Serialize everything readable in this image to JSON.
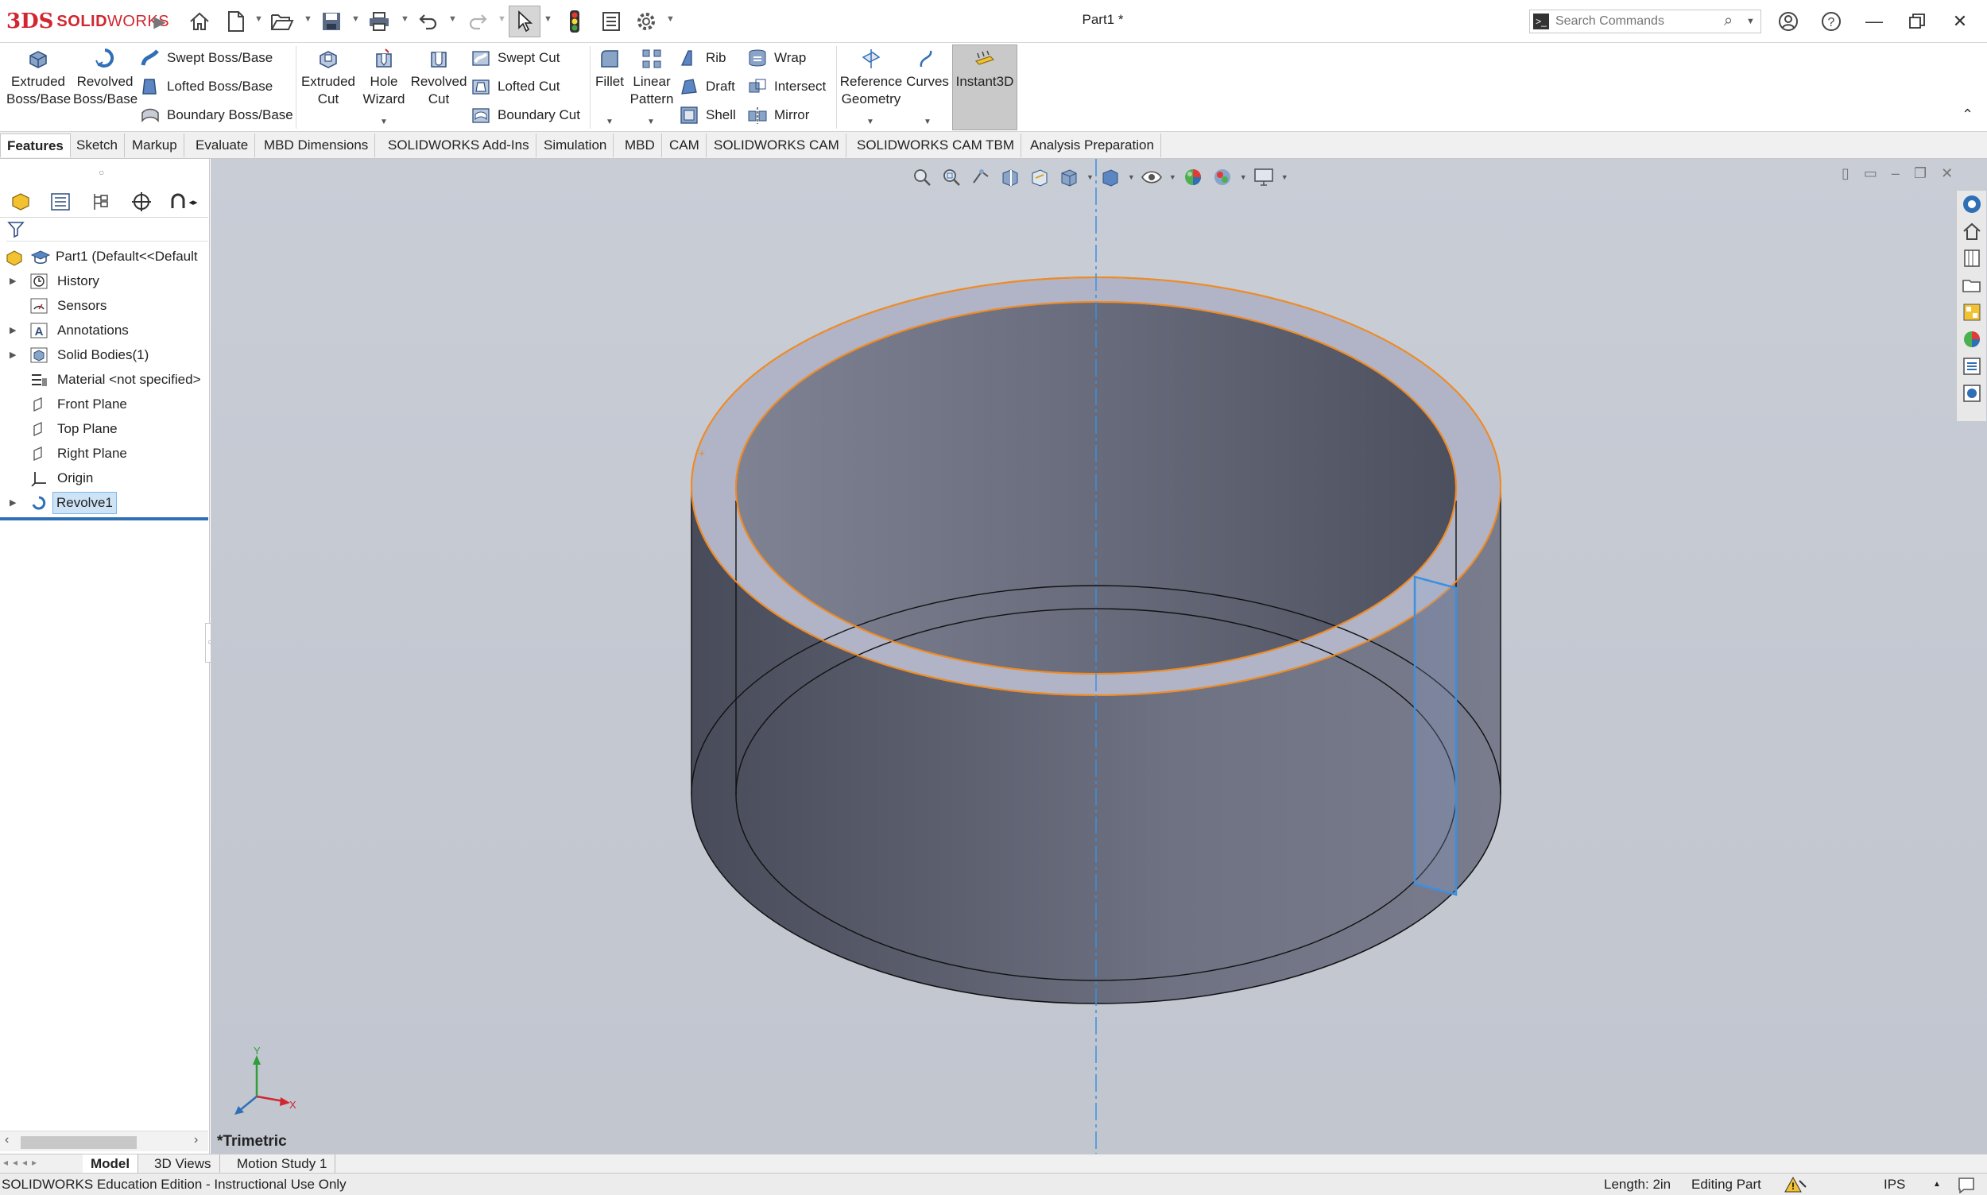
{
  "app": {
    "brand_prefix": "3DS",
    "brand_bold": "SOLID",
    "brand_rest": "WORKS",
    "doc_title": "Part1 *"
  },
  "search": {
    "placeholder": "Search Commands"
  },
  "ribbon": {
    "extruded_boss": [
      "Extruded",
      "Boss/Base"
    ],
    "revolved_boss": [
      "Revolved",
      "Boss/Base"
    ],
    "swept_boss": "Swept Boss/Base",
    "lofted_boss": "Lofted Boss/Base",
    "boundary_boss": "Boundary Boss/Base",
    "extruded_cut": [
      "Extruded",
      "Cut"
    ],
    "hole_wizard": [
      "Hole",
      "Wizard"
    ],
    "revolved_cut": [
      "Revolved",
      "Cut"
    ],
    "swept_cut": "Swept Cut",
    "lofted_cut": "Lofted Cut",
    "boundary_cut": "Boundary Cut",
    "fillet": "Fillet",
    "linear_pattern": [
      "Linear",
      "Pattern"
    ],
    "rib": "Rib",
    "draft": "Draft",
    "shell": "Shell",
    "wrap": "Wrap",
    "intersect": "Intersect",
    "mirror": "Mirror",
    "reference_geometry": [
      "Reference",
      "Geometry"
    ],
    "curves": "Curves",
    "instant3d": "Instant3D"
  },
  "tabs": [
    "Features",
    "Sketch",
    "Markup",
    "Evaluate",
    "MBD Dimensions",
    "SOLIDWORKS Add-Ins",
    "Simulation",
    "MBD",
    "CAM",
    "SOLIDWORKS CAM",
    "SOLIDWORKS CAM TBM",
    "Analysis Preparation"
  ],
  "tree": {
    "root": "Part1  (Default<<Default",
    "items": [
      {
        "label": "History"
      },
      {
        "label": "Sensors"
      },
      {
        "label": "Annotations"
      },
      {
        "label": "Solid Bodies(1)"
      },
      {
        "label": "Material <not specified>"
      },
      {
        "label": "Front Plane"
      },
      {
        "label": "Top Plane"
      },
      {
        "label": "Right Plane"
      },
      {
        "label": "Origin"
      },
      {
        "label": "Revolve1"
      }
    ]
  },
  "viewport": {
    "orientation": "*Trimetric",
    "triad": {
      "x": "X",
      "y": "Y"
    }
  },
  "bottom_tabs": [
    "Model",
    "3D Views",
    "Motion Study 1"
  ],
  "status": {
    "edition": "SOLIDWORKS Education Edition - Instructional Use Only",
    "length": "Length: 2in",
    "mode": "Editing Part",
    "units": "IPS"
  },
  "colors": {
    "brand_red": "#d22630",
    "edge_highlight": "#f08a24",
    "selection_blue": "#3d8fe0",
    "body_gray": "#6f7382"
  }
}
